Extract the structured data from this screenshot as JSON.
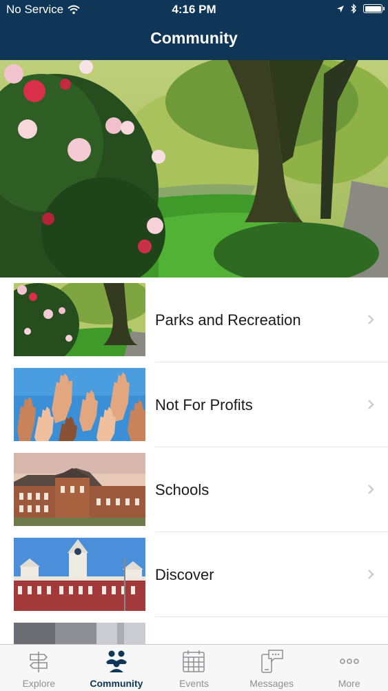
{
  "status_bar": {
    "carrier": "No Service",
    "time": "4:16 PM"
  },
  "nav": {
    "title": "Community"
  },
  "list": {
    "items": [
      {
        "label": "Parks and Recreation",
        "image": "park-photo"
      },
      {
        "label": "Not For Profits",
        "image": "raised-hands-photo"
      },
      {
        "label": "Schools",
        "image": "school-building-photo"
      },
      {
        "label": "Discover",
        "image": "courthouse-photo"
      },
      {
        "label": "",
        "image": "partial-photo"
      }
    ]
  },
  "tabbar": {
    "tabs": [
      {
        "label": "Explore",
        "icon": "signpost-icon"
      },
      {
        "label": "Community",
        "icon": "people-icon",
        "active": true
      },
      {
        "label": "Events",
        "icon": "calendar-icon"
      },
      {
        "label": "Messages",
        "icon": "phone-message-icon"
      },
      {
        "label": "More",
        "icon": "more-dots-icon"
      }
    ]
  },
  "colors": {
    "nav_bg": "#0f3557",
    "active_tab": "#0f3557",
    "inactive_tab": "#8e8e93"
  }
}
